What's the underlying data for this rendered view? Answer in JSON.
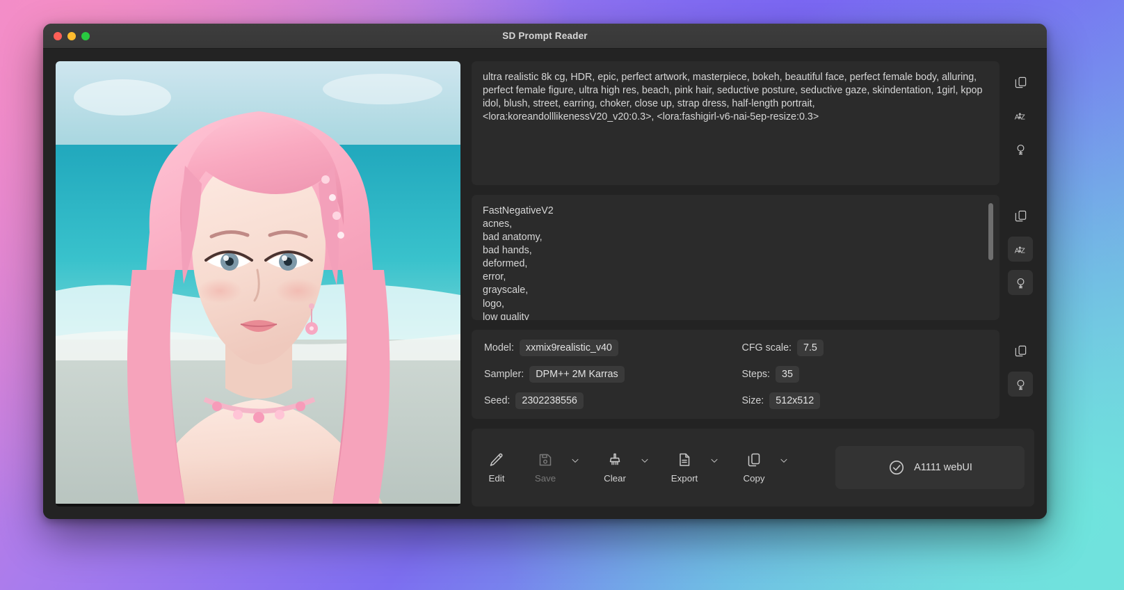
{
  "window": {
    "title": "SD Prompt Reader",
    "traffic_lights": [
      "close",
      "minimize",
      "zoom"
    ]
  },
  "preview": {
    "alt": "AI generated portrait of a woman with long pink hair wearing a floral choker at a beach"
  },
  "positive_prompt": {
    "text": "ultra realistic 8k cg, HDR, epic, perfect artwork, masterpiece, bokeh, beautiful face, perfect female body, alluring, perfect female figure, ultra high res, beach, pink hair, seductive posture, seductive gaze, skindentation, 1girl, kpop idol, blush, street, earring, choker, close up, strap dress, half-length portrait, <lora:koreandolllikenessV20_v20:0.3>, <lora:fashigirl-v6-nai-5ep-resize:0.3>",
    "actions": [
      "copy-icon",
      "sort-az-icon",
      "bulb-icon"
    ]
  },
  "negative_prompt": {
    "text": "FastNegativeV2\nacnes,\nbad anatomy,\nbad hands,\ndeformed,\nerror,\ngrayscale,\nlogo,\nlow quality",
    "actions": [
      "copy-icon",
      "sort-az-icon",
      "bulb-icon"
    ]
  },
  "parameters": {
    "left": [
      {
        "label": "Model:",
        "value": "xxmix9realistic_v40"
      },
      {
        "label": "Sampler:",
        "value": "DPM++ 2M Karras"
      },
      {
        "label": "Seed:",
        "value": "2302238556"
      }
    ],
    "right": [
      {
        "label": "CFG scale:",
        "value": "7.5"
      },
      {
        "label": "Steps:",
        "value": "35"
      },
      {
        "label": "Size:",
        "value": "512x512"
      }
    ],
    "actions": [
      "copy-icon",
      "bulb-icon"
    ]
  },
  "toolbar": {
    "buttons": [
      {
        "label": "Edit",
        "icon": "pencil-icon",
        "disabled": false,
        "has_caret": false
      },
      {
        "label": "Save",
        "icon": "floppy-icon",
        "disabled": true,
        "has_caret": true
      },
      {
        "label": "Clear",
        "icon": "brush-icon",
        "disabled": false,
        "has_caret": true
      },
      {
        "label": "Export",
        "icon": "document-icon",
        "disabled": false,
        "has_caret": true
      },
      {
        "label": "Copy",
        "icon": "copy-icon",
        "disabled": false,
        "has_caret": true
      }
    ],
    "status": {
      "label": "A1111 webUI",
      "icon": "check-circle-icon"
    }
  },
  "colors": {
    "window_bg": "#232323",
    "panel_bg": "#2b2b2b",
    "value_chip": "#3a3a3a",
    "text": "#d6d6d6",
    "text_dim": "#787878",
    "titlebar": "#3b3b3b"
  }
}
